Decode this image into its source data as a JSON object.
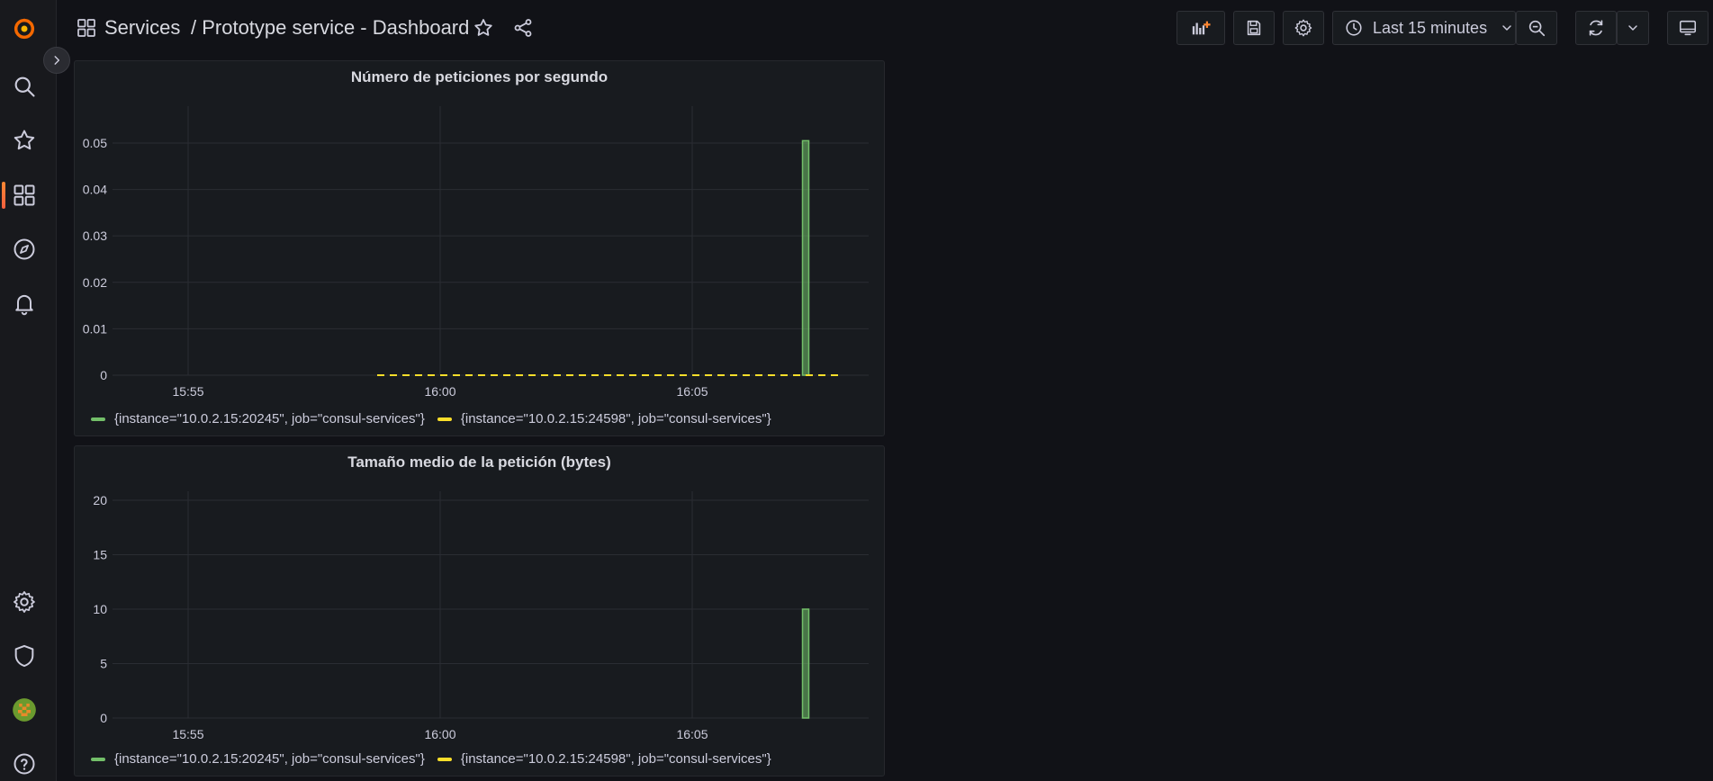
{
  "breadcrumb": {
    "folder": "Services",
    "title": "/ Prototype service - Dashboard"
  },
  "toolbar": {
    "time_range": "Last 15 minutes"
  },
  "icons": {
    "sidebar": [
      "grafana-logo-icon",
      "search-icon",
      "star-icon",
      "dashboards-icon",
      "explore-icon",
      "alerting-icon",
      "configuration-icon",
      "shield-icon",
      "avatar",
      "help-icon"
    ],
    "toolbar": [
      "add-panel-icon",
      "save-icon",
      "settings-icon",
      "clock-icon",
      "chevron-down-icon",
      "zoom-out-icon",
      "refresh-icon",
      "chevron-down-icon",
      "tv-mode-icon"
    ]
  },
  "colors": {
    "accent": "#f55f3e",
    "series1": "#73bf69",
    "series2": "#fade2a"
  },
  "panels": [
    {
      "title": "Número de peticiones por segundo",
      "legend": [
        {
          "label": "{instance=\"10.0.2.15:20245\", job=\"consul-services\"}",
          "color": "#73bf69"
        },
        {
          "label": "{instance=\"10.0.2.15:24598\", job=\"consul-services\"}",
          "color": "#fade2a"
        }
      ]
    },
    {
      "title": "Tamaño medio de la petición (bytes)",
      "legend": [
        {
          "label": "{instance=\"10.0.2.15:20245\", job=\"consul-services\"}",
          "color": "#73bf69"
        },
        {
          "label": "{instance=\"10.0.2.15:24598\", job=\"consul-services\"}",
          "color": "#fade2a"
        }
      ]
    }
  ],
  "chart_data": [
    {
      "type": "bar",
      "title": "Número de peticiones por segundo",
      "x_ticks": [
        "15:55",
        "16:00",
        "16:05"
      ],
      "x_range": [
        "15:53:30",
        "16:08:30"
      ],
      "ylim": [
        0,
        0.056
      ],
      "y_ticks": [
        0,
        0.01,
        0.02,
        0.03,
        0.04,
        0.05
      ],
      "y_tick_labels": [
        "0",
        "0.01",
        "0.02",
        "0.03",
        "0.04",
        "0.05"
      ],
      "grid": true,
      "legend_placement": "bottom-left",
      "series": [
        {
          "name": "{instance=\"10.0.2.15:20245\", job=\"consul-services\"}",
          "style": "bar",
          "color": "#73bf69",
          "points": [
            {
              "x": "16:07:15",
              "y": 0.0505
            }
          ]
        },
        {
          "name": "{instance=\"10.0.2.15:24598\", job=\"consul-services\"}",
          "style": "dashed-line",
          "color": "#fade2a",
          "x_start": "15:58:45",
          "x_end": "16:08:00",
          "y": 0
        }
      ]
    },
    {
      "type": "bar",
      "title": "Tamaño medio de la petición (bytes)",
      "x_ticks": [
        "15:55",
        "16:00",
        "16:05"
      ],
      "x_range": [
        "15:53:30",
        "16:08:30"
      ],
      "ylim": [
        0,
        20
      ],
      "y_ticks": [
        0,
        5,
        10,
        15,
        20
      ],
      "y_tick_labels": [
        "0",
        "5",
        "10",
        "15",
        "20"
      ],
      "grid": true,
      "legend_placement": "bottom-left",
      "series": [
        {
          "name": "{instance=\"10.0.2.15:20245\", job=\"consul-services\"}",
          "style": "bar",
          "color": "#73bf69",
          "points": [
            {
              "x": "16:07:15",
              "y": 10
            }
          ]
        },
        {
          "name": "{instance=\"10.0.2.15:24598\", job=\"consul-services\"}",
          "style": "bar",
          "color": "#fade2a",
          "points": []
        }
      ]
    }
  ]
}
